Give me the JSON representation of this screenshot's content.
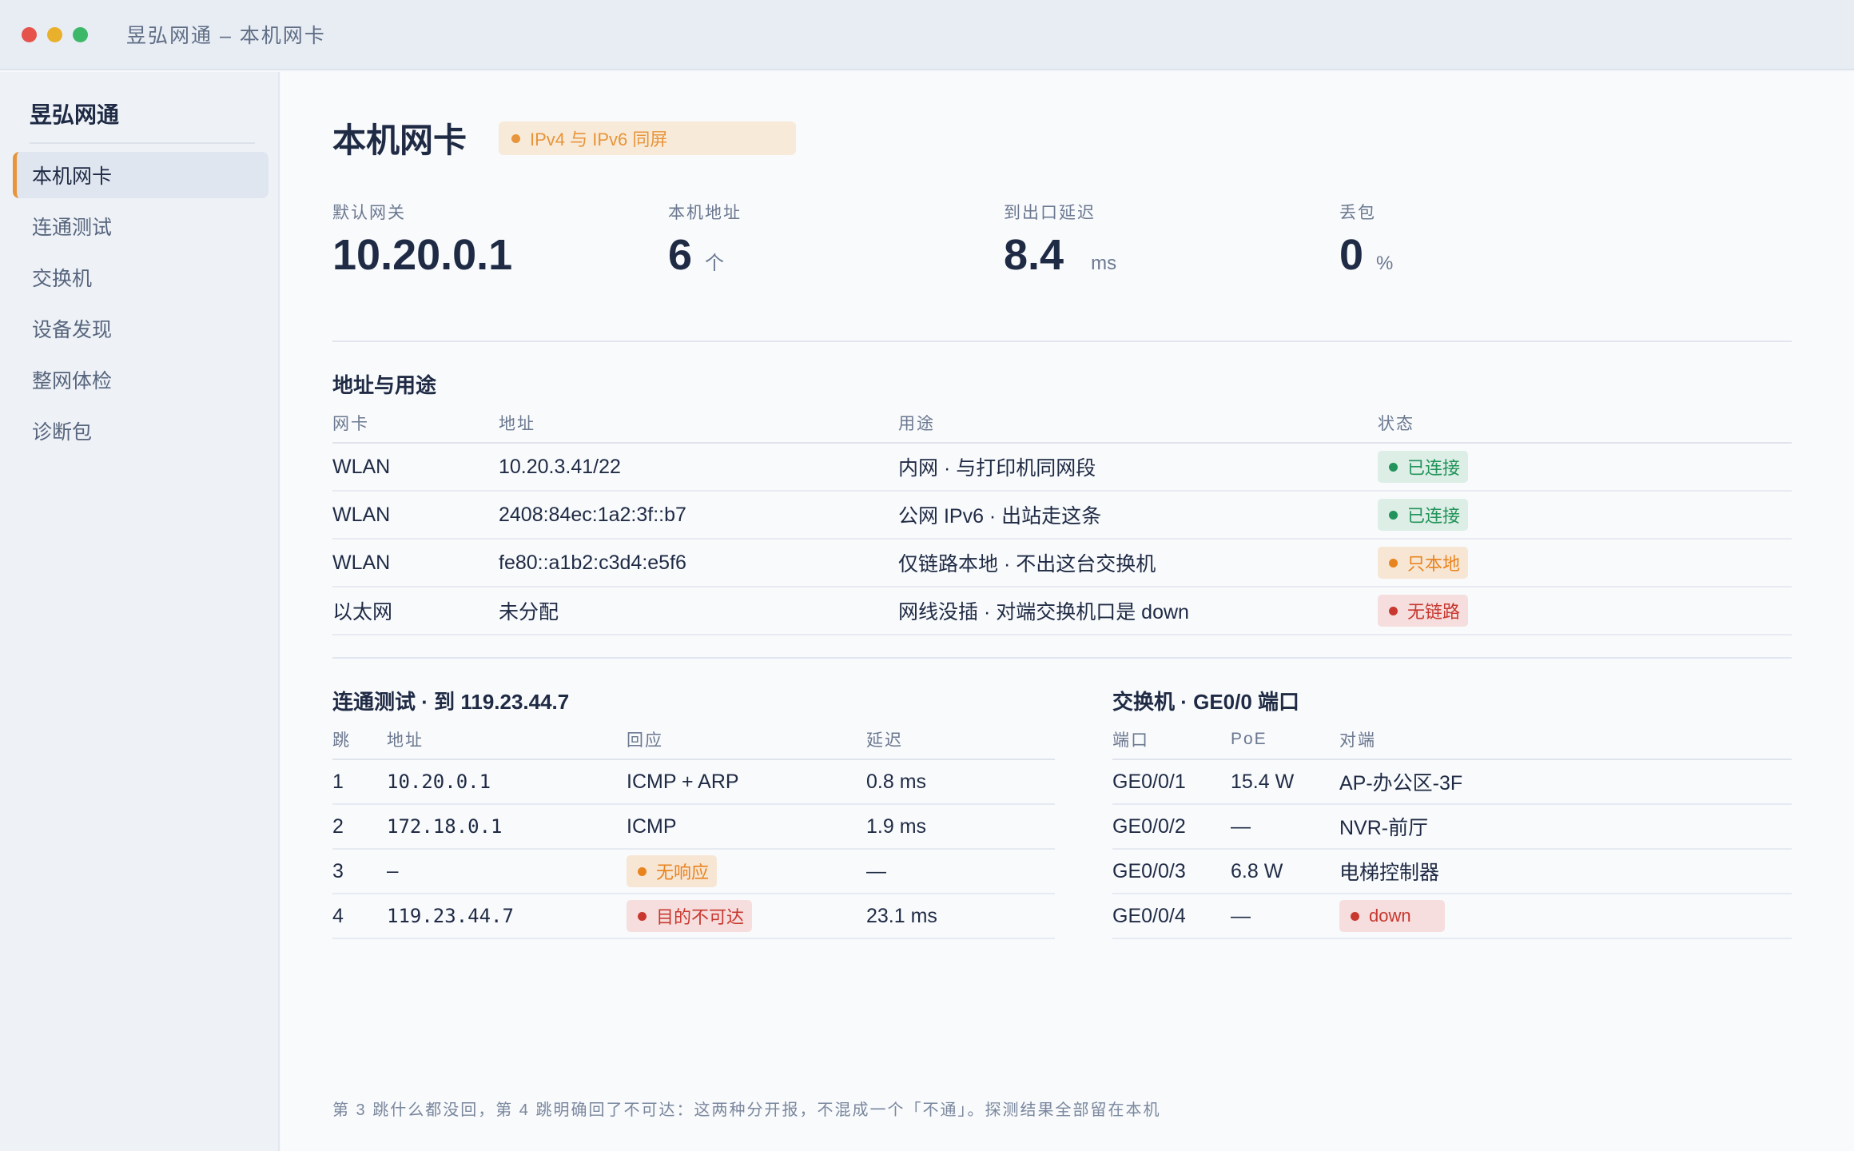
{
  "window": {
    "title": "昱弘网通 – 本机网卡"
  },
  "sidebar": {
    "brand": "昱弘网通",
    "items": [
      {
        "label": "本机网卡",
        "active": true
      },
      {
        "label": "连通测试"
      },
      {
        "label": "交换机"
      },
      {
        "label": "设备发现"
      },
      {
        "label": "整网体检"
      },
      {
        "label": "诊断包"
      }
    ]
  },
  "header": {
    "title": "本机网卡",
    "note": "IPv4 与 IPv6 同屏"
  },
  "stats": [
    {
      "label": "默认网关",
      "value": "10.20.0.1",
      "unit": ""
    },
    {
      "label": "本机地址",
      "value": "6",
      "unit": "个"
    },
    {
      "label": "到出口延迟",
      "value": "8.4",
      "unit": "ms"
    },
    {
      "label": "丢包",
      "value": "0",
      "unit": "%"
    }
  ],
  "addresses": {
    "title": "地址与用途",
    "columns": [
      "网卡",
      "地址",
      "用途",
      "状态"
    ],
    "rows": [
      {
        "nic": "WLAN",
        "address": "10.20.3.41/22",
        "usage": "内网 · 与打印机同网段",
        "status": "已连接",
        "tone": "green"
      },
      {
        "nic": "WLAN",
        "address": "2408:84ec:1a2:3f::b7",
        "usage": "公网 IPv6 · 出站走这条",
        "status": "已连接",
        "tone": "green"
      },
      {
        "nic": "WLAN",
        "address": "fe80::a1b2:c3d4:e5f6",
        "usage": "仅链路本地 · 不出这台交换机",
        "status": "只本地",
        "tone": "orange"
      },
      {
        "nic": "以太网",
        "address": "未分配",
        "usage": "网线没插 · 对端交换机口是 down",
        "status": "无链路",
        "tone": "red"
      }
    ]
  },
  "trace": {
    "title": "连通测试 · 到 119.23.44.7",
    "columns": [
      "跳",
      "地址",
      "回应",
      "延迟"
    ],
    "rows": [
      {
        "hop": "1",
        "address": "10.20.0.1",
        "reply": "ICMP + ARP",
        "reply_tone": "",
        "latency": "0.8 ms"
      },
      {
        "hop": "2",
        "address": "172.18.0.1",
        "reply": "ICMP",
        "reply_tone": "",
        "latency": "1.9 ms"
      },
      {
        "hop": "3",
        "address": "—",
        "reply": "无响应",
        "reply_tone": "orange",
        "latency": "—"
      },
      {
        "hop": "4",
        "address": "119.23.44.7",
        "reply": "目的不可达",
        "reply_tone": "red",
        "latency": "23.1 ms"
      }
    ]
  },
  "switch": {
    "title": "交换机 · GE0/0 端口",
    "columns": [
      "端口",
      "PoE",
      "对端"
    ],
    "rows": [
      {
        "port": "GE0/0/1",
        "poe": "15.4 W",
        "peer": "AP-办公区-3F",
        "peer_tone": ""
      },
      {
        "port": "GE0/0/2",
        "poe": "—",
        "peer": "NVR-前厅",
        "peer_tone": ""
      },
      {
        "port": "GE0/0/3",
        "poe": "6.8 W",
        "peer": "电梯控制器",
        "peer_tone": ""
      },
      {
        "port": "GE0/0/4",
        "poe": "—",
        "peer": "down",
        "peer_tone": "red"
      }
    ]
  },
  "footnote": "第 3 跳什么都没回，第 4 跳明确回了不可达：这两种分开报，不混成一个「不通」。探测结果全部留在本机"
}
